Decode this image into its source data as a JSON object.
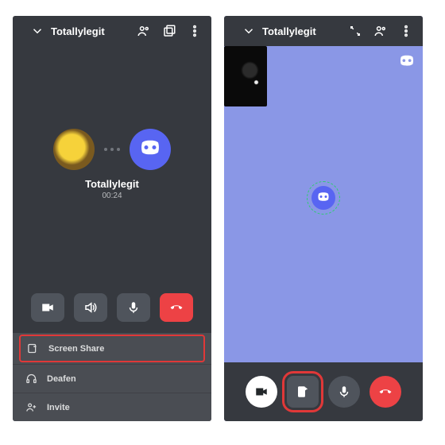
{
  "colors": {
    "accent": "#5865f2",
    "danger": "#ed4245",
    "highlight": "#e03838",
    "shared_bg": "#8a97e6"
  },
  "left": {
    "header": {
      "title": "Totallylegit"
    },
    "call": {
      "participant_name": "Totallylegit",
      "timer": "00:24"
    },
    "controls": {
      "video": "video-icon",
      "speaker": "speaker-icon",
      "mic": "mic-icon",
      "hangup": "hangup-icon"
    },
    "sheet": {
      "items": [
        {
          "icon": "screen-share-icon",
          "label": "Screen Share",
          "highlighted": true
        },
        {
          "icon": "headphones-icon",
          "label": "Deafen"
        },
        {
          "icon": "invite-icon",
          "label": "Invite"
        }
      ]
    }
  },
  "right": {
    "header": {
      "title": "Totallylegit"
    },
    "footer": {
      "controls": [
        "video",
        "screen-share",
        "mic",
        "hangup"
      ],
      "highlighted_index": 1
    }
  }
}
